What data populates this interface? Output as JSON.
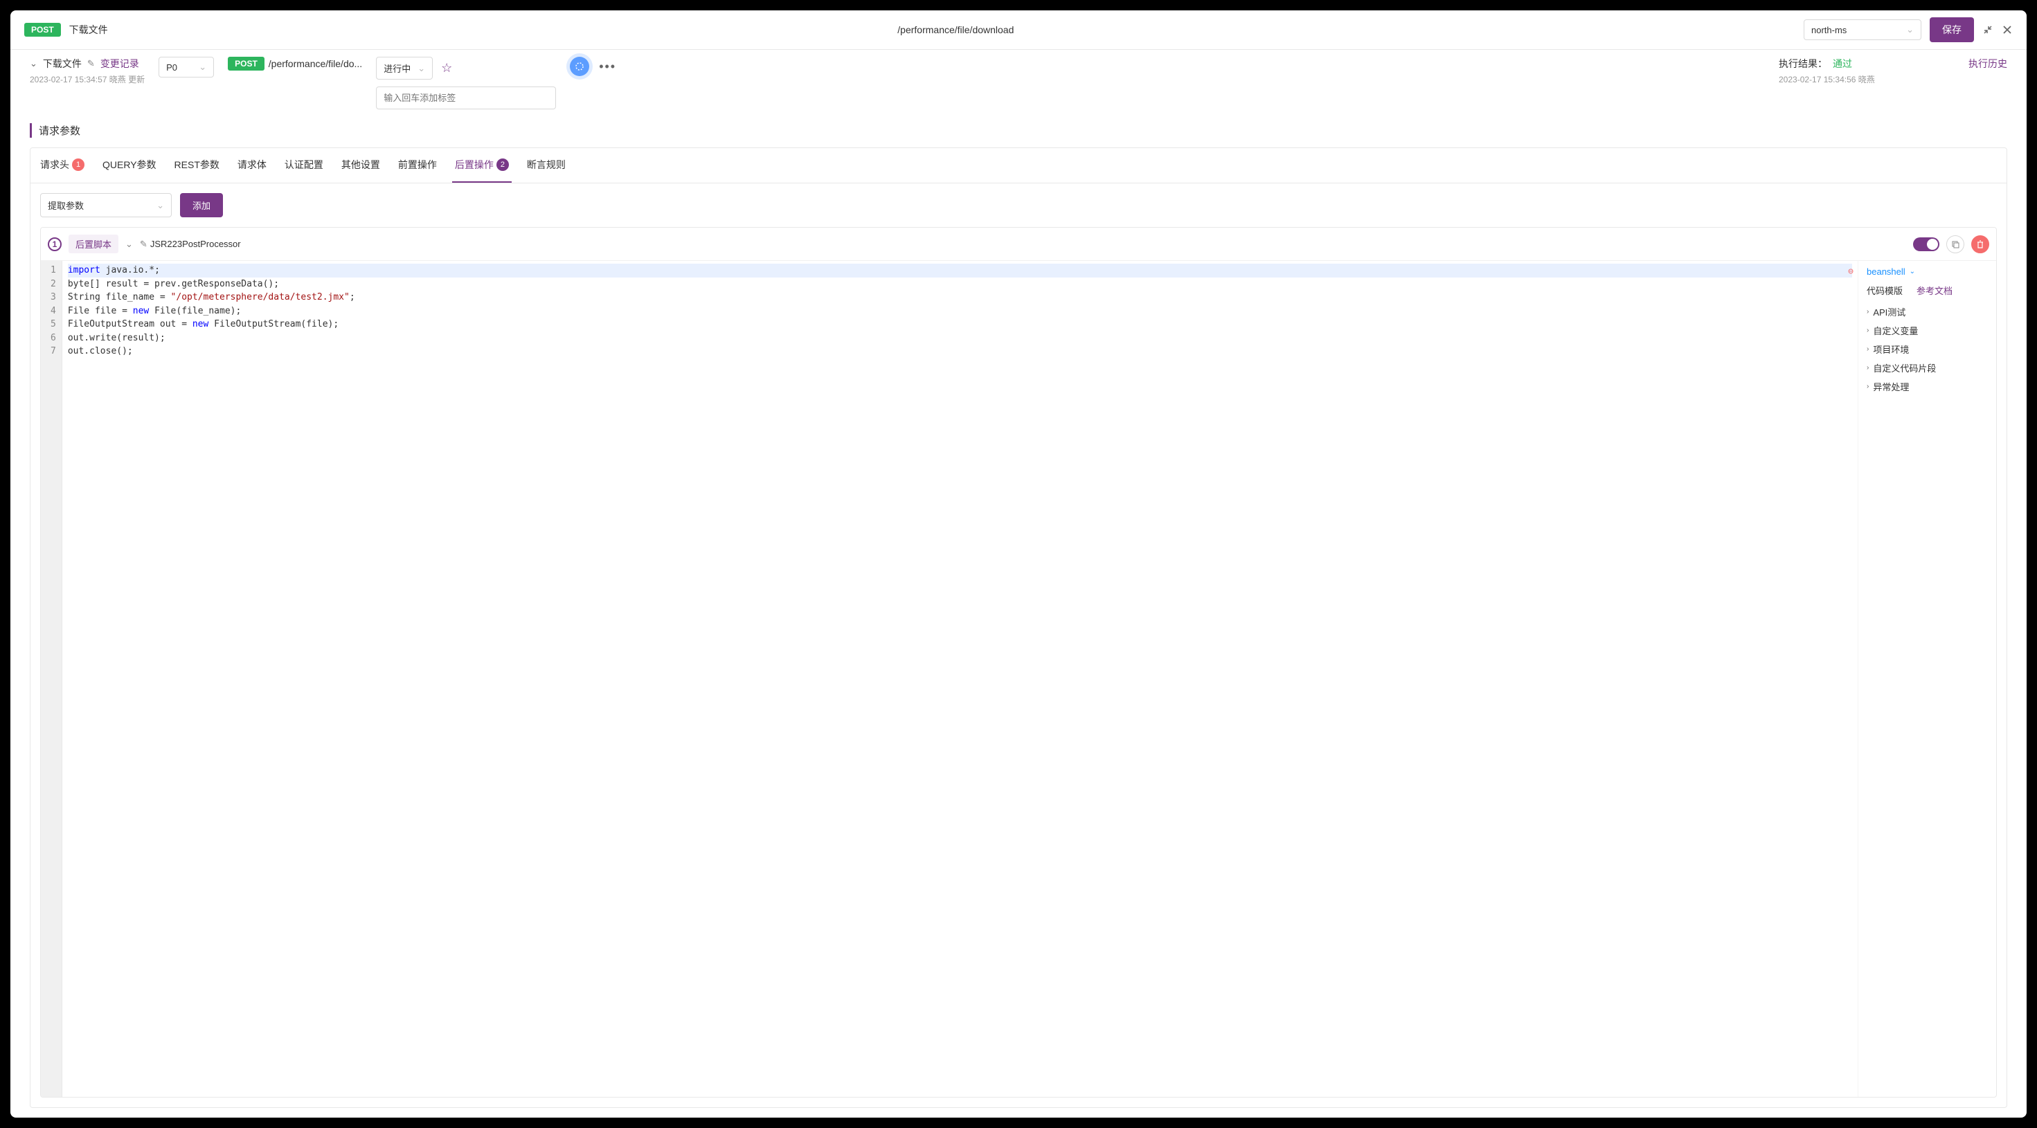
{
  "topbar": {
    "method": "POST",
    "title": "下载文件",
    "path": "/performance/file/download",
    "env": "north-ms",
    "save": "保存"
  },
  "subheader": {
    "name": "下载文件",
    "changeLog": "变更记录",
    "meta": "2023-02-17 15:34:57 晓燕 更新",
    "priority": "P0",
    "method": "POST",
    "pathShort": "/performance/file/do...",
    "status": "进行中",
    "tagPlaceholder": "输入回车添加标签",
    "resultLabel": "执行结果：",
    "resultValue": "通过",
    "resultMeta": "2023-02-17 15:34:56 晓燕",
    "historyLink": "执行历史"
  },
  "sectionTitle": "请求参数",
  "tabs": [
    {
      "label": "请求头",
      "badge": "1",
      "badgeColor": "red"
    },
    {
      "label": "QUERY参数"
    },
    {
      "label": "REST参数"
    },
    {
      "label": "请求体"
    },
    {
      "label": "认证配置"
    },
    {
      "label": "其他设置"
    },
    {
      "label": "前置操作"
    },
    {
      "label": "后置操作",
      "badge": "2",
      "badgeColor": "purple",
      "active": true
    },
    {
      "label": "断言规则"
    }
  ],
  "extract": {
    "placeholder": "提取参数",
    "addBtn": "添加"
  },
  "script": {
    "stepNum": "1",
    "tag": "后置脚本",
    "processor": "JSR223PostProcessor",
    "lang": "beanshell",
    "codeTemplate": "代码模版",
    "refDoc": "参考文档",
    "tree": [
      "API测试",
      "自定义变量",
      "项目环境",
      "自定义代码片段",
      "异常处理"
    ],
    "code": [
      {
        "n": "1",
        "tokens": [
          {
            "t": "import",
            "c": "kw"
          },
          {
            "t": " java.io.*;"
          }
        ]
      },
      {
        "n": "2",
        "tokens": [
          {
            "t": "byte"
          },
          {
            "t": "[] result = prev.getResponseData();"
          }
        ]
      },
      {
        "n": "3",
        "tokens": [
          {
            "t": "String"
          },
          {
            "t": " file_name = "
          },
          {
            "t": "\"/opt/metersphere/data/test2.jmx\"",
            "c": "str"
          },
          {
            "t": ";"
          }
        ]
      },
      {
        "n": "4",
        "tokens": [
          {
            "t": "File"
          },
          {
            "t": " file = "
          },
          {
            "t": "new",
            "c": "kw"
          },
          {
            "t": " File(file_name);"
          }
        ]
      },
      {
        "n": "5",
        "tokens": [
          {
            "t": "FileOutputStream"
          },
          {
            "t": " out = "
          },
          {
            "t": "new",
            "c": "kw"
          },
          {
            "t": " FileOutputStream(file);"
          }
        ]
      },
      {
        "n": "6",
        "tokens": [
          {
            "t": "out.write(result);"
          }
        ]
      },
      {
        "n": "7",
        "tokens": [
          {
            "t": "out.close();"
          }
        ]
      }
    ]
  }
}
